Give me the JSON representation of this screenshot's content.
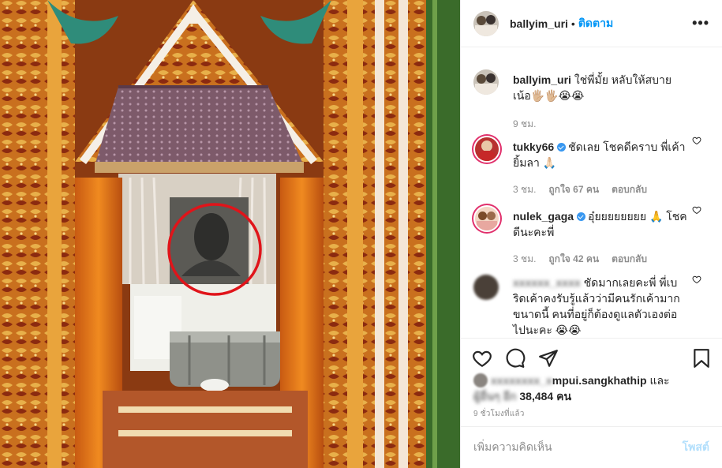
{
  "post": {
    "username": "ballyim_uri",
    "dot": "•",
    "follow_label": "ติดตาม",
    "more_icon": "•••",
    "image_alt": "decorated pavilion with encircled figure"
  },
  "caption": {
    "username": "ballyim_uri",
    "text": "ใช่พี่มั้ย หลับให้สบายเน้อ🖐🏼🖐🏼😭😭",
    "time": "9 ชม."
  },
  "comments": [
    {
      "username": "tukky66",
      "verified": true,
      "text": "ชัดเลย โชคดีคราบ พี่เค้ายิ้มลา 🙏🏻",
      "time": "3 ชม.",
      "likes": "ถูกใจ 67 คน",
      "reply": "ตอบกลับ"
    },
    {
      "username": "nulek_gaga",
      "verified": true,
      "text": "อุ๋ยยยยยยยย 🙏 โชคดีนะคะพี่",
      "time": "3 ชม.",
      "likes": "ถูกใจ 42 คน",
      "reply": "ตอบกลับ"
    },
    {
      "username": "xxxxxx_xxxx",
      "verified": false,
      "text": "ชัดมากเลยคะพี่ พี่เบริดเค้าคงรับรู้แล้วว่ามีคนรักเค้ามากขนาดนี้ คนที่อยู่ก็ต้องดูแลตัวเองต่อไปนะคะ 😭😭"
    }
  ],
  "likes": {
    "blurred_user": "xxxxxxxx_x",
    "user": "mpui.sangkhathip",
    "and": "และ",
    "others_blurred": "ผู้อื่นๆ อีก",
    "count": "38,484 คน"
  },
  "timestamp": "9 ชั่วโมงที่แล้ว",
  "add_comment": {
    "placeholder": "เพิ่มความคิดเห็น",
    "post_label": "โพสต์"
  },
  "colors": {
    "link": "#0095f6",
    "post_disabled": "#b2dffc",
    "verified": "#3897f0",
    "circle": "#e0141a"
  }
}
